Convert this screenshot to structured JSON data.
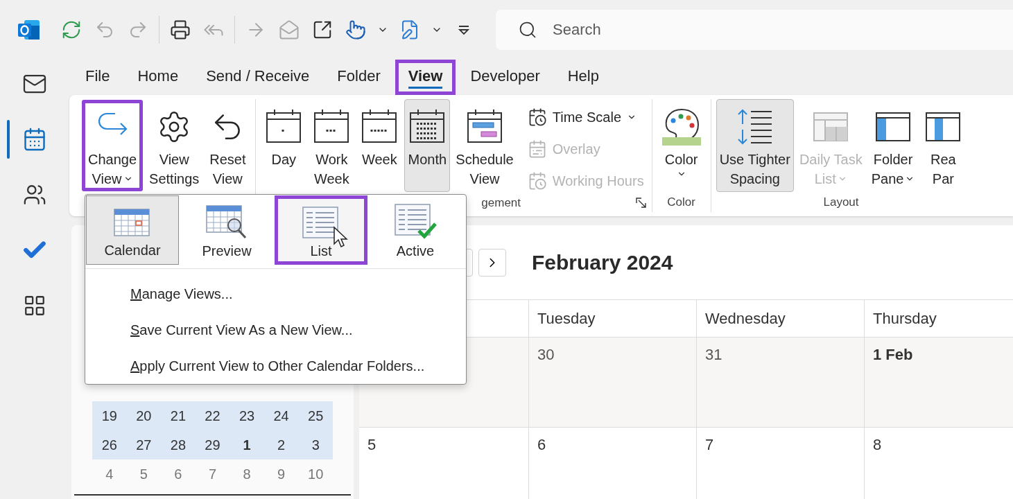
{
  "quick_access": [
    {
      "kind": "sync",
      "disabled": false
    },
    {
      "kind": "undo",
      "disabled": true
    },
    {
      "kind": "redo",
      "disabled": true
    },
    {
      "kind": "separator"
    },
    {
      "kind": "print",
      "disabled": false
    },
    {
      "kind": "reply-all",
      "disabled": true
    },
    {
      "kind": "separator"
    },
    {
      "kind": "forward",
      "disabled": true
    },
    {
      "kind": "mail-open",
      "disabled": true
    },
    {
      "kind": "popout",
      "disabled": false
    },
    {
      "kind": "touch",
      "disabled": false
    },
    {
      "kind": "caret",
      "disabled": false
    },
    {
      "kind": "edit",
      "disabled": false
    },
    {
      "kind": "caret",
      "disabled": false
    },
    {
      "kind": "customize",
      "disabled": false
    }
  ],
  "search": {
    "placeholder": "Search"
  },
  "app_rail": {
    "items": [
      {
        "kind": "mail",
        "selected": false
      },
      {
        "kind": "calendar",
        "selected": true
      },
      {
        "kind": "people",
        "selected": false
      },
      {
        "kind": "todo",
        "selected": false
      },
      {
        "kind": "apps",
        "selected": false
      }
    ]
  },
  "tabs": [
    {
      "label": "File",
      "selected": false,
      "highlighted": false
    },
    {
      "label": "Home",
      "selected": false,
      "highlighted": false
    },
    {
      "label": "Send / Receive",
      "selected": false,
      "highlighted": false
    },
    {
      "label": "Folder",
      "selected": false,
      "highlighted": false
    },
    {
      "label": "View",
      "selected": true,
      "highlighted": true
    },
    {
      "label": "Developer",
      "selected": false,
      "highlighted": false
    },
    {
      "label": "Help",
      "selected": false,
      "highlighted": false
    }
  ],
  "ribbon": {
    "groups": [
      {
        "buttons": [
          {
            "kind": "change-view",
            "lines": [
              "Change",
              "View"
            ],
            "caret": true,
            "selected": false,
            "disabled": false,
            "highlighted": true
          },
          {
            "kind": "settings",
            "lines": [
              "View",
              "Settings"
            ],
            "caret": false,
            "selected": false,
            "disabled": false,
            "highlighted": false
          },
          {
            "kind": "reset",
            "lines": [
              "Reset",
              "View"
            ],
            "caret": false,
            "selected": false,
            "disabled": false,
            "highlighted": false
          }
        ]
      },
      {
        "label": "gement",
        "launcher": true,
        "buttons": [
          {
            "kind": "day",
            "lines": [
              "Day"
            ],
            "caret": false,
            "selected": false,
            "disabled": false,
            "highlighted": false
          },
          {
            "kind": "work-week",
            "lines": [
              "Work",
              "Week"
            ],
            "caret": false,
            "selected": false,
            "disabled": false,
            "highlighted": false
          },
          {
            "kind": "week",
            "lines": [
              "Week"
            ],
            "caret": false,
            "selected": false,
            "disabled": false,
            "highlighted": false
          },
          {
            "kind": "month",
            "lines": [
              "Month"
            ],
            "caret": false,
            "selected": true,
            "disabled": false,
            "highlighted": false
          },
          {
            "kind": "schedule",
            "lines": [
              "Schedule",
              "View"
            ],
            "caret": false,
            "selected": false,
            "disabled": false,
            "highlighted": false
          }
        ],
        "small_buttons": [
          {
            "kind": "time-scale",
            "label": "Time Scale",
            "caret": true,
            "disabled": false
          },
          {
            "kind": "overlay",
            "label": "Overlay",
            "caret": false,
            "disabled": true
          },
          {
            "kind": "working-hours",
            "label": "Working Hours",
            "caret": false,
            "disabled": true
          }
        ]
      },
      {
        "label": "Color",
        "buttons": [
          {
            "kind": "palette",
            "lines": [
              "Color"
            ],
            "caret": true,
            "selected": false,
            "disabled": false,
            "highlighted": false
          }
        ]
      },
      {
        "label": "Layout",
        "buttons": [
          {
            "kind": "tighter",
            "lines": [
              "Use Tighter",
              "Spacing"
            ],
            "caret": false,
            "selected": true,
            "disabled": false,
            "highlighted": false
          },
          {
            "kind": "daily-task",
            "lines": [
              "Daily Task",
              "List"
            ],
            "caret": true,
            "selected": false,
            "disabled": true,
            "highlighted": false
          },
          {
            "kind": "folder-pane",
            "lines": [
              "Folder",
              "Pane"
            ],
            "caret": true,
            "selected": false,
            "disabled": false,
            "highlighted": false
          },
          {
            "kind": "reading-pane",
            "lines": [
              "Rea",
              "Par"
            ],
            "caret": false,
            "selected": false,
            "disabled": false,
            "highlighted": false
          }
        ]
      }
    ]
  },
  "change_view_menu": {
    "views": [
      {
        "kind": "calendar",
        "label": "Calendar",
        "selected": true,
        "hovered": false,
        "highlighted": false
      },
      {
        "kind": "preview",
        "label": "Preview",
        "selected": false,
        "hovered": false,
        "highlighted": false
      },
      {
        "kind": "list",
        "label": "List",
        "selected": false,
        "hovered": true,
        "highlighted": true
      },
      {
        "kind": "active",
        "label": "Active",
        "selected": false,
        "hovered": false,
        "highlighted": false
      }
    ],
    "commands": [
      "Manage Views...",
      "Save Current View As a New View...",
      "Apply Current View to Other Calendar Folders..."
    ]
  },
  "mini_calendar": {
    "weeks": [
      {
        "in_range": true,
        "days": [
          {
            "label": "19",
            "today": false
          },
          {
            "label": "20",
            "today": false
          },
          {
            "label": "21",
            "today": false
          },
          {
            "label": "22",
            "today": false
          },
          {
            "label": "23",
            "today": false
          },
          {
            "label": "24",
            "today": false
          },
          {
            "label": "25",
            "today": false
          }
        ]
      },
      {
        "in_range": true,
        "days": [
          {
            "label": "26",
            "today": false
          },
          {
            "label": "27",
            "today": false
          },
          {
            "label": "28",
            "today": false
          },
          {
            "label": "29",
            "today": false
          },
          {
            "label": "1",
            "today": true
          },
          {
            "label": "2",
            "today": false
          },
          {
            "label": "3",
            "today": false
          }
        ]
      },
      {
        "in_range": false,
        "days": [
          {
            "label": "4",
            "today": false
          },
          {
            "label": "5",
            "today": false
          },
          {
            "label": "6",
            "today": false
          },
          {
            "label": "7",
            "today": false
          },
          {
            "label": "8",
            "today": false
          },
          {
            "label": "9",
            "today": false
          },
          {
            "label": "10",
            "today": false
          }
        ]
      }
    ]
  },
  "calendar": {
    "title": "February 2024",
    "day_headers": [
      "Tuesday",
      "Wednesday",
      "Thursday"
    ],
    "weeks": [
      {
        "shaded": true,
        "days": [
          {
            "label": "30",
            "today": false
          },
          {
            "label": "31",
            "today": false
          },
          {
            "label": "1 Feb",
            "today": true
          }
        ]
      },
      {
        "shaded": false,
        "days": [
          {
            "label": "5",
            "today": false
          },
          {
            "label": "6",
            "today": false
          },
          {
            "label": "7",
            "today": false
          },
          {
            "label": "8",
            "today": false
          }
        ]
      }
    ]
  }
}
